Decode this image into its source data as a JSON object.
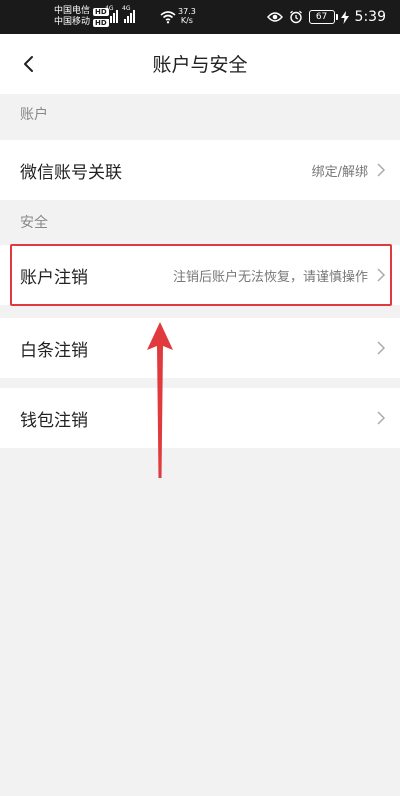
{
  "status_bar": {
    "carrier1": "中国电信",
    "carrier2": "中国移动",
    "hd_badge": "HD",
    "network_1": "4G",
    "network_2": "4G",
    "speed_value": "37.3",
    "speed_unit": "K/s",
    "battery": "67",
    "time": "5:39"
  },
  "header": {
    "title": "账户与安全"
  },
  "sections": {
    "account_label": "账户",
    "security_label": "安全"
  },
  "rows": {
    "wechat": {
      "label": "微信账号关联",
      "value": "绑定/解绑"
    },
    "account_cancel": {
      "label": "账户注销",
      "value": "注销后账户无法恢复，请谨慎操作"
    },
    "baitiao_cancel": {
      "label": "白条注销",
      "value": ""
    },
    "wallet_cancel": {
      "label": "钱包注销",
      "value": ""
    }
  },
  "colors": {
    "highlight": "#e0393e",
    "background": "#f2f2f2",
    "status_bar": "#1a1a1a"
  }
}
